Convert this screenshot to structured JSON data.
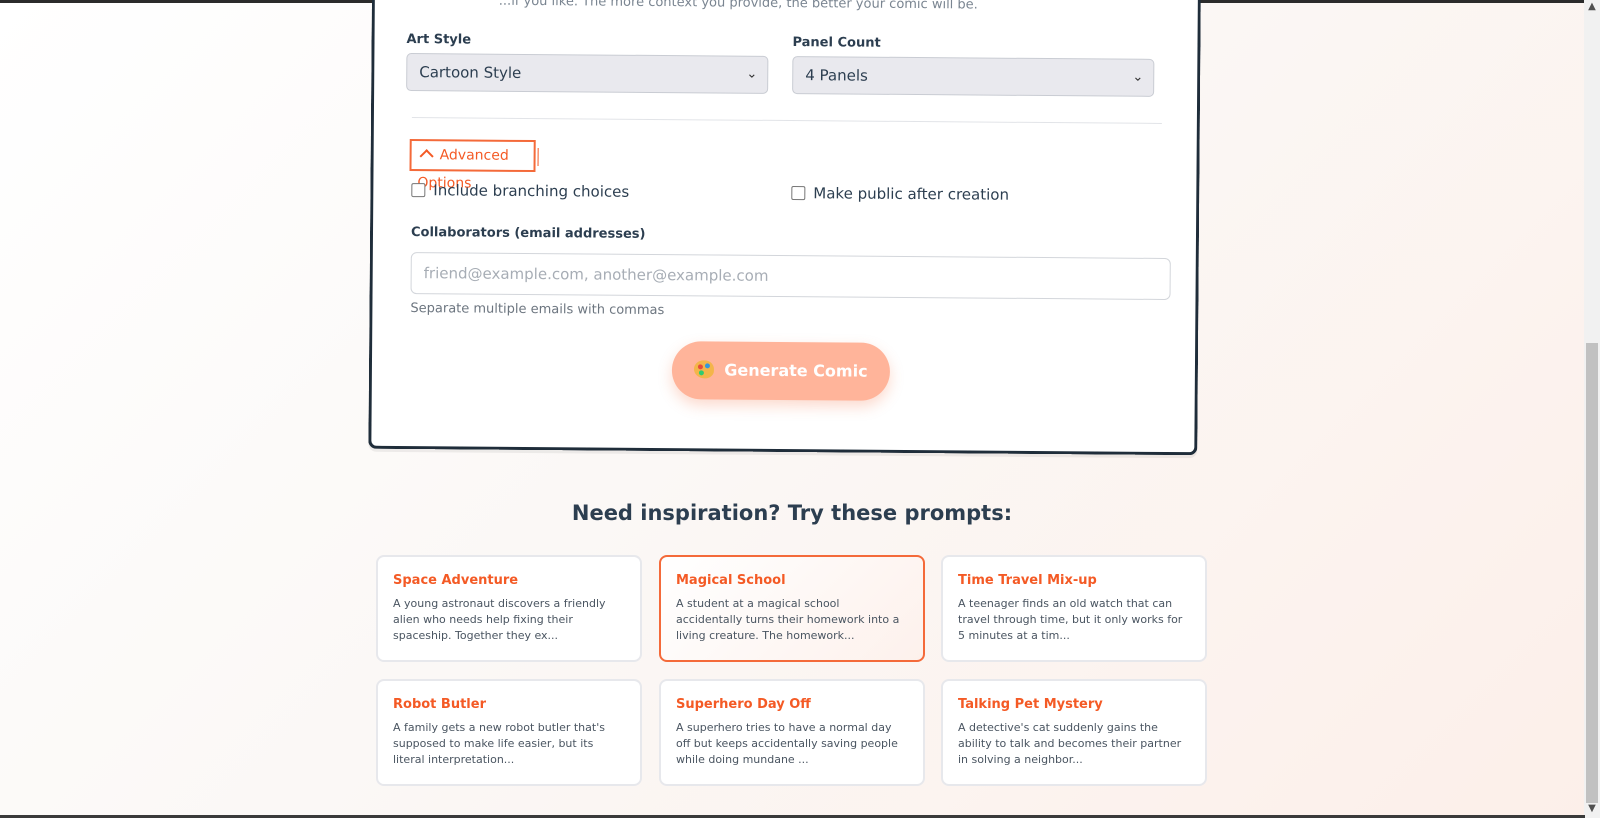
{
  "form": {
    "cut_hint": "...if you like. The more context you provide, the better your comic will be.",
    "art_style": {
      "label": "Art Style",
      "value": "Cartoon Style"
    },
    "panel_count": {
      "label": "Panel Count",
      "value": "4 Panels"
    },
    "advanced_options_label": "Advanced Options",
    "branching_label": "Include branching choices",
    "public_label": "Make public after creation",
    "collaborators": {
      "label": "Collaborators (email addresses)",
      "placeholder": "friend@example.com, another@example.com",
      "hint": "Separate multiple emails with commas"
    },
    "generate_label": "Generate Comic"
  },
  "inspiration": {
    "title": "Need inspiration? Try these prompts:",
    "prompts": [
      {
        "title": "Space Adventure",
        "text": "A young astronaut discovers a friendly alien who needs help fixing their spaceship. Together they ex..."
      },
      {
        "title": "Magical School",
        "text": "A student at a magical school accidentally turns their homework into a living creature. The homework..."
      },
      {
        "title": "Time Travel Mix-up",
        "text": "A teenager finds an old watch that can travel through time, but it only works for 5 minutes at a tim..."
      },
      {
        "title": "Robot Butler",
        "text": "A family gets a new robot butler that's supposed to make life easier, but its literal interpretation..."
      },
      {
        "title": "Superhero Day Off",
        "text": "A superhero tries to have a normal day off but keeps accidentally saving people while doing mundane ..."
      },
      {
        "title": "Talking Pet Mystery",
        "text": "A detective's cat suddenly gains the ability to talk and becomes their partner in solving a neighbor..."
      }
    ]
  },
  "colors": {
    "accent": "#f45a25",
    "button": "#ffb49a",
    "text": "#2c3e50"
  },
  "icons": {
    "generate": "palette-icon",
    "advanced": "chevron-up-icon",
    "select": "chevron-down-icon"
  }
}
